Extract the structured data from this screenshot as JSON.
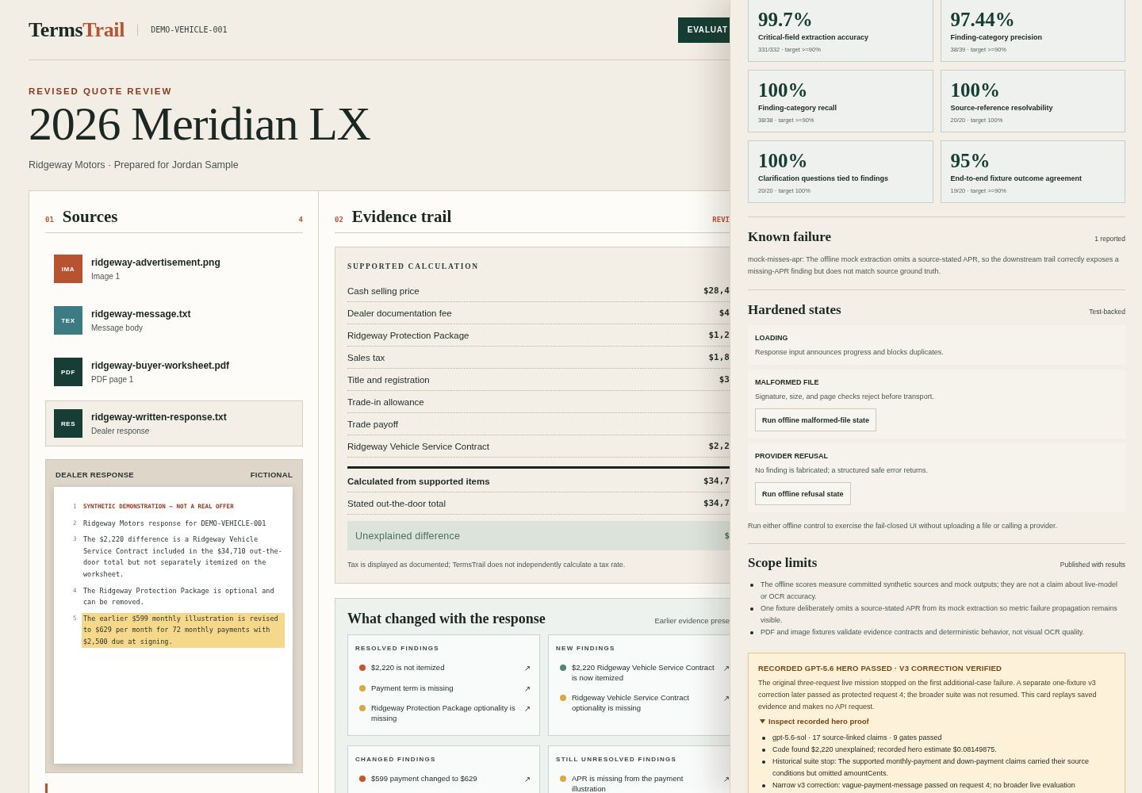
{
  "header": {
    "brand": {
      "primary": "Terms",
      "accent": "Trail"
    },
    "vehicle_id": "DEMO-VEHICLE-001",
    "action_button": "EVALUAT"
  },
  "hero": {
    "eyebrow": "REVISED QUOTE REVIEW",
    "title": "2026 Meridian LX",
    "subtitle": "Ridgeway Motors · Prepared for Jordan Sample"
  },
  "sources": {
    "number": "01",
    "title": "Sources",
    "count": "4",
    "items": [
      {
        "badge": "IMA",
        "color": "#b85332",
        "name": "ridgeway-advertisement.png",
        "detail": "Image 1",
        "selected": false
      },
      {
        "badge": "TEX",
        "color": "#3b7b82",
        "name": "ridgeway-message.txt",
        "detail": "Message body",
        "selected": false
      },
      {
        "badge": "PDF",
        "color": "#173d35",
        "name": "ridgeway-buyer-worksheet.pdf",
        "detail": "PDF page 1",
        "selected": false
      },
      {
        "badge": "RES",
        "color": "#173d35",
        "name": "ridgeway-written-response.txt",
        "detail": "Dealer response",
        "selected": true
      }
    ]
  },
  "dealer_response": {
    "title": "DEALER RESPONSE",
    "tag": "FICTIONAL",
    "lines": [
      {
        "number": "1",
        "kind": "notice",
        "text": "SYNTHETIC DEMONSTRATION — NOT A REAL OFFER",
        "highlighted": false
      },
      {
        "number": "2",
        "kind": "text",
        "text": "Ridgeway Motors response for DEMO-VEHICLE-001",
        "highlighted": false
      },
      {
        "number": "3",
        "kind": "text",
        "text": "The $2,220 difference is a Ridgeway Vehicle Service Contract included in the $34,710 out-the-door total but not separately itemized on the worksheet.",
        "highlighted": false
      },
      {
        "number": "4",
        "kind": "text",
        "text": "The Ridgeway Protection Package is optional and can be removed.",
        "highlighted": false
      },
      {
        "number": "5",
        "kind": "text",
        "text": "The earlier $599 monthly illustration is revised to $629 per month for 72 monthly payments with $2,500 due at signing.",
        "highlighted": true
      }
    ]
  },
  "evidence_trail": {
    "number": "02",
    "title": "Evidence trail",
    "status": "REVI",
    "calculation": {
      "title": "SUPPORTED CALCULATION",
      "rows": [
        {
          "label": "Cash selling price",
          "value": "$28,4"
        },
        {
          "label": "Dealer documentation fee",
          "value": "$4"
        },
        {
          "label": "Ridgeway Protection Package",
          "value": "$1,2"
        },
        {
          "label": "Sales tax",
          "value": "$1,8"
        },
        {
          "label": "Title and registration",
          "value": "$3"
        },
        {
          "label": "Trade-in allowance"
        },
        {
          "label": "Trade payoff"
        },
        {
          "label": "Ridgeway Vehicle Service Contract",
          "value": "$2,2"
        }
      ],
      "totals": [
        {
          "kind": "calculated",
          "label": "Calculated from supported items",
          "value": "$34,7"
        },
        {
          "kind": "stated",
          "label": "Stated out-the-door total",
          "value": "$34,7"
        }
      ],
      "difference": {
        "label": "Unexplained difference",
        "value": "$"
      },
      "note": "Tax is displayed as documented; TermsTrail does not independently calculate a tax rate."
    },
    "changes": {
      "title": "What changed with the response",
      "note": "Earlier evidence prese",
      "groups": [
        {
          "title": "RESOLVED FINDINGS",
          "findings": [
            {
              "text": "$2,220 is not itemized",
              "color": "#c4552f"
            },
            {
              "text": "Payment term is missing",
              "color": "#d8a93e"
            },
            {
              "text": "Ridgeway Protection Package optionality is missing",
              "color": "#d8a93e"
            }
          ]
        },
        {
          "title": "NEW FINDINGS",
          "findings": [
            {
              "text": "$2,220 Ridgeway Vehicle Service Contract is now itemized",
              "color": "#4c8a6e"
            },
            {
              "text": "Ridgeway Vehicle Service Contract optionality is missing",
              "color": "#d8a93e"
            }
          ]
        },
        {
          "title": "CHANGED FINDINGS",
          "findings": [
            {
              "text": "$599 payment changed to $629",
              "color": "#c4552f"
            }
          ]
        },
        {
          "title": "STILL UNRESOLVED FINDINGS",
          "findings": [
            {
              "text": "APR is missing from the payment illustration",
              "color": "#d8a93e"
            }
          ]
        }
      ]
    }
  },
  "evaluation": {
    "metrics": [
      {
        "value": "99.7%",
        "label": "Critical-field extraction accuracy",
        "detail": "331/332 · target >=90%"
      },
      {
        "value": "97.44%",
        "label": "Finding-category precision",
        "detail": "38/39 · target >=90%"
      },
      {
        "value": "100%",
        "label": "Finding-category recall",
        "detail": "38/38 · target >=90%"
      },
      {
        "value": "100%",
        "label": "Source-reference resolvability",
        "detail": "20/20 · target 100%"
      },
      {
        "value": "100%",
        "label": "Clarification questions tied to findings",
        "detail": "20/20 · target 100%"
      },
      {
        "value": "95%",
        "label": "End-to-end fixture outcome agreement",
        "detail": "19/20 · target >=90%"
      }
    ],
    "known_failure": {
      "title": "Known failure",
      "meta": "1 reported",
      "text": "mock-misses-apr: The offline mock extraction omits a source-stated APR, so the downstream trail correctly exposes a missing-APR finding but does not match source ground truth."
    },
    "hardened_states": {
      "title": "Hardened states",
      "meta": "Test-backed",
      "states": [
        {
          "title": "LOADING",
          "text": "Response input announces progress and blocks duplicates."
        },
        {
          "title": "MALFORMED FILE",
          "text": "Signature, size, and page checks reject before transport.",
          "button": "Run offline malformed-file state"
        },
        {
          "title": "PROVIDER REFUSAL",
          "text": "No finding is fabricated; a structured safe error returns.",
          "button": "Run offline refusal state"
        }
      ],
      "note": "Run either offline control to exercise the fail-closed UI without uploading a file or calling a provider."
    },
    "scope_limits": {
      "title": "Scope limits",
      "meta": "Published with results",
      "items": [
        "The offline scores measure committed synthetic sources and mock outputs; they are not a claim about live-model or OCR accuracy.",
        "One fixture deliberately omits a source-stated APR from its mock extraction so metric failure propagation remains visible.",
        "PDF and image fixtures validate evidence contracts and deterministic behavior, not visual OCR quality."
      ]
    },
    "hero_proof": {
      "title": "RECORDED GPT-5.6 HERO PASSED · V3 CORRECTION VERIFIED",
      "text": "The original three-request live mission stopped on the first additional-case failure. A separate one-fixture v3 correction later passed as protected request 4; the broader suite was not resumed. This card replays saved evidence and makes no API request.",
      "toggle": "Inspect recorded hero proof",
      "expanded": true,
      "items": [
        "gpt-5.6-sol · 17 source-linked claims · 9 gates passed",
        "Code found $2,220 unexplained; recorded hero estimate $0.08149875.",
        "Historical suite stop: The supported monthly-payment and down-payment claims carried their source conditions but omitted amountCents.",
        "Narrow v3 correction: vague-payment-message passed on request 4; no broader live evaluation"
      ]
    }
  }
}
